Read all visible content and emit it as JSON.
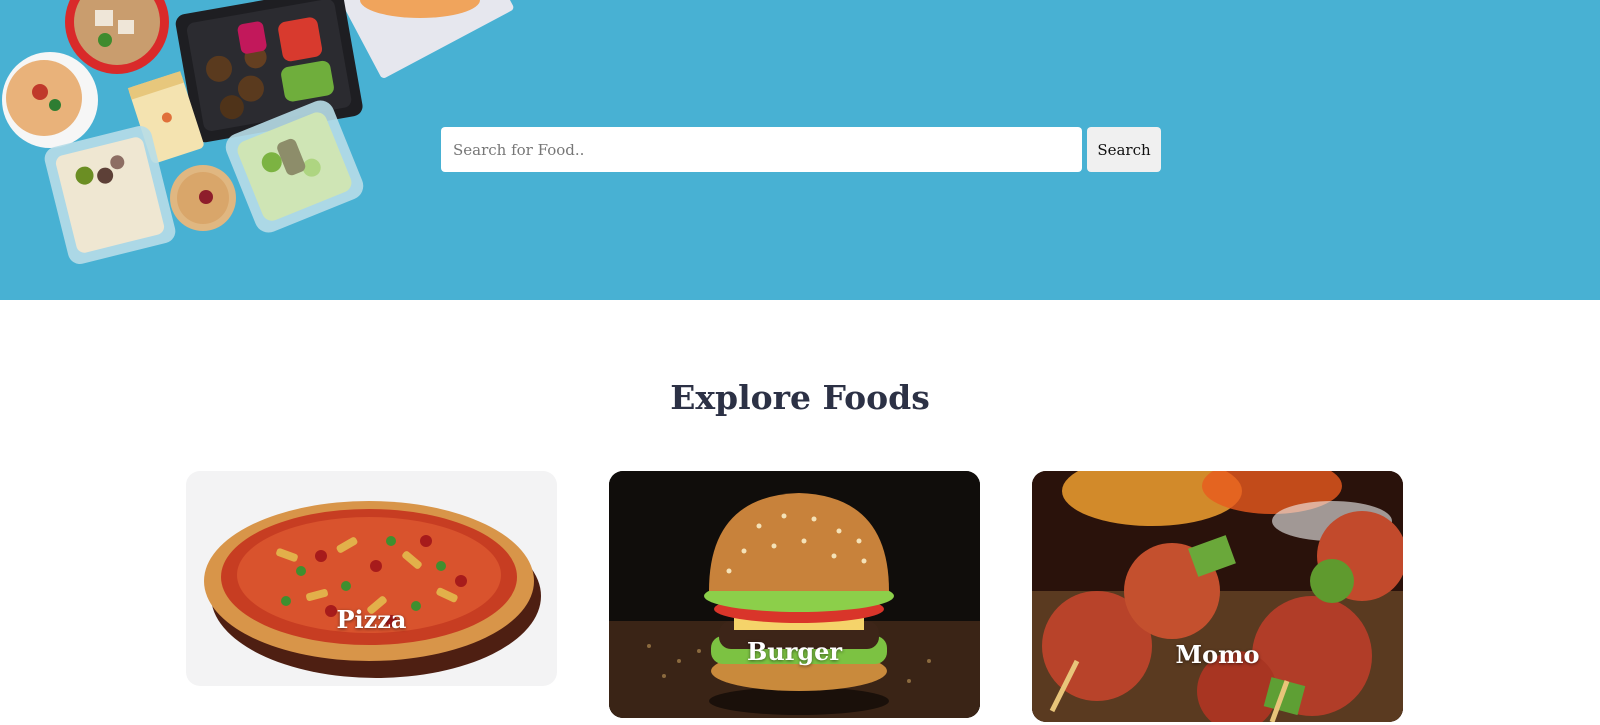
{
  "search": {
    "placeholder": "Search for Food..",
    "button_label": "Search"
  },
  "explore": {
    "title": "Explore Foods",
    "cards": [
      {
        "label": "Pizza"
      },
      {
        "label": "Burger"
      },
      {
        "label": "Momo"
      }
    ]
  },
  "colors": {
    "hero_background": "#48b1d3",
    "heading": "#2c3145"
  },
  "icons": {
    "hero": "food-containers-illustration",
    "pizza": "pizza-illustration",
    "burger": "burger-illustration",
    "momo": "momo-illustration"
  }
}
